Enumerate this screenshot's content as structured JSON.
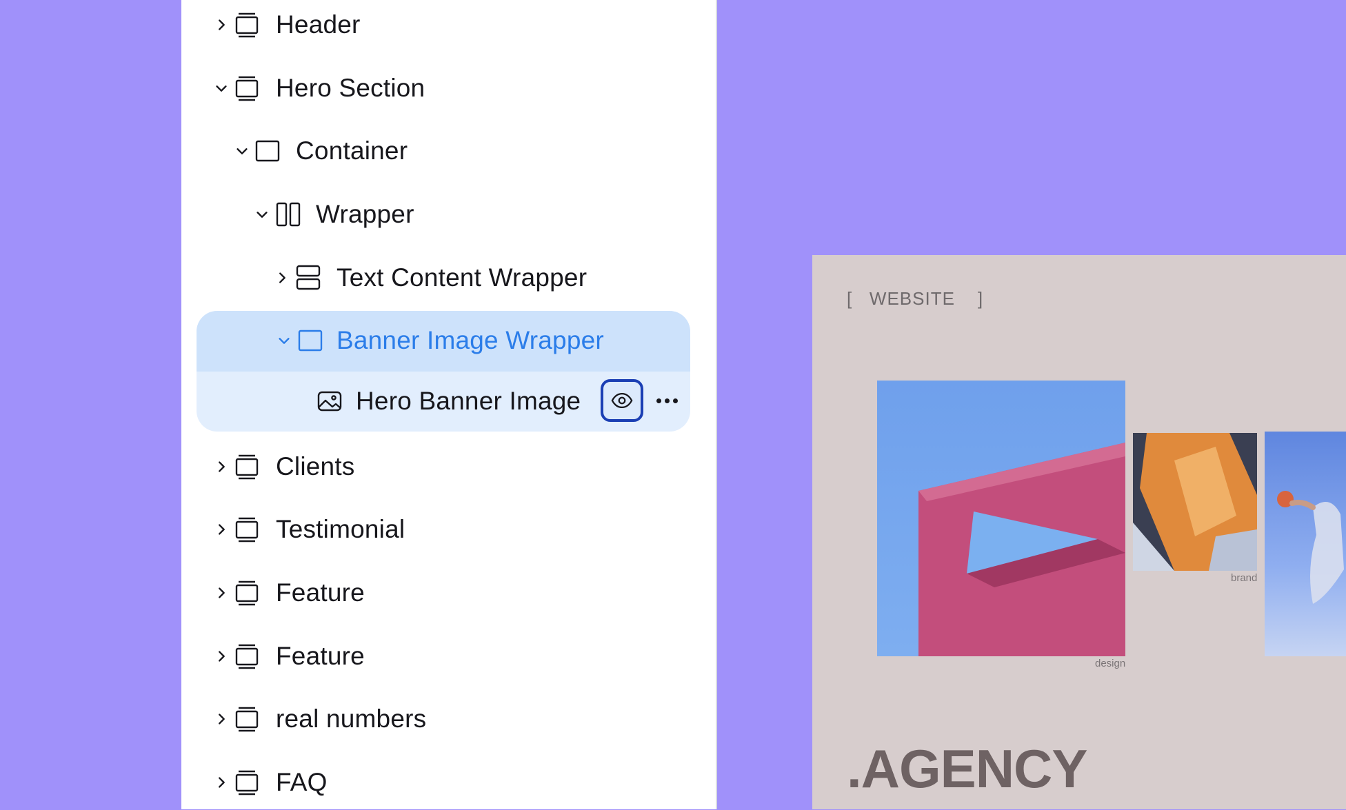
{
  "layers": {
    "items": [
      {
        "label": "Header",
        "icon": "section-icon",
        "expanded": false
      },
      {
        "label": "Hero Section",
        "icon": "section-icon",
        "expanded": true
      },
      {
        "label": "Container",
        "icon": "container-icon",
        "expanded": true
      },
      {
        "label": "Wrapper",
        "icon": "columns-icon",
        "expanded": true
      },
      {
        "label": "Text Content Wrapper",
        "icon": "rows-icon",
        "expanded": false
      },
      {
        "label": "Banner Image Wrapper",
        "icon": "container-icon",
        "expanded": true,
        "selected": true
      },
      {
        "label": "Hero Banner Image",
        "icon": "image-icon"
      },
      {
        "label": "Clients",
        "icon": "section-icon",
        "expanded": false
      },
      {
        "label": "Testimonial",
        "icon": "section-icon",
        "expanded": false
      },
      {
        "label": "Feature",
        "icon": "section-icon",
        "expanded": false
      },
      {
        "label": "Feature",
        "icon": "section-icon",
        "expanded": false
      },
      {
        "label": "real numbers",
        "icon": "section-icon",
        "expanded": false
      },
      {
        "label": "FAQ",
        "icon": "section-icon",
        "expanded": false
      }
    ],
    "accent_color": "#2b7de9",
    "selected_bg": "#cde2fb",
    "child_bg": "#e2eefd",
    "focus_color": "#1b3fb4"
  },
  "preview": {
    "tag_open": "[",
    "tag_text": "WEBSITE",
    "tag_close": "]",
    "caption_main": "design",
    "caption_brand": "brand",
    "headline": ".AGENCY",
    "bg_color": "#d7cdcd",
    "canvas_color": "#a091fa"
  }
}
